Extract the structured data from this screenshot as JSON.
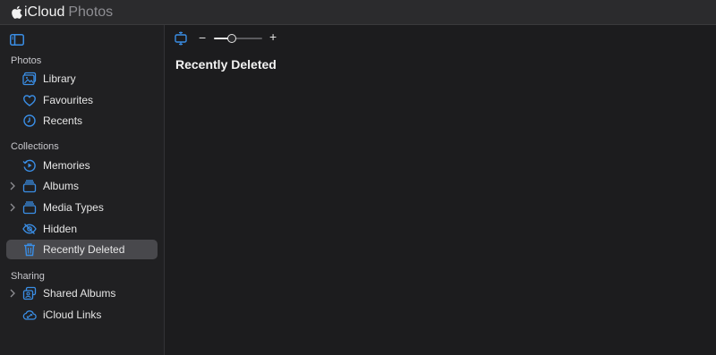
{
  "app": {
    "brand_icloud": "iCloud",
    "brand_photos": "Photos"
  },
  "sidebar": {
    "sections": [
      {
        "title": "Photos"
      },
      {
        "title": "Collections"
      },
      {
        "title": "Sharing"
      }
    ],
    "items": [
      {
        "label": "Library",
        "icon": "library-icon"
      },
      {
        "label": "Favourites",
        "icon": "heart-icon"
      },
      {
        "label": "Recents",
        "icon": "clock-icon"
      },
      {
        "label": "Memories",
        "icon": "memories-icon"
      },
      {
        "label": "Albums",
        "icon": "album-icon",
        "expandable": true
      },
      {
        "label": "Media Types",
        "icon": "media-types-icon",
        "expandable": true
      },
      {
        "label": "Hidden",
        "icon": "eye-slash-icon"
      },
      {
        "label": "Recently Deleted",
        "icon": "trash-icon",
        "selected": true
      },
      {
        "label": "Shared Albums",
        "icon": "shared-albums-icon",
        "expandable": true
      },
      {
        "label": "iCloud Links",
        "icon": "cloud-link-icon"
      }
    ]
  },
  "toolbar": {
    "zoom_minus": "−",
    "zoom_plus": "+",
    "zoom_level": 0.35
  },
  "main": {
    "title": "Recently Deleted"
  },
  "colors": {
    "accent": "#3a8ee6",
    "selected_bg": "#48484c",
    "background": "#1c1c1e"
  }
}
